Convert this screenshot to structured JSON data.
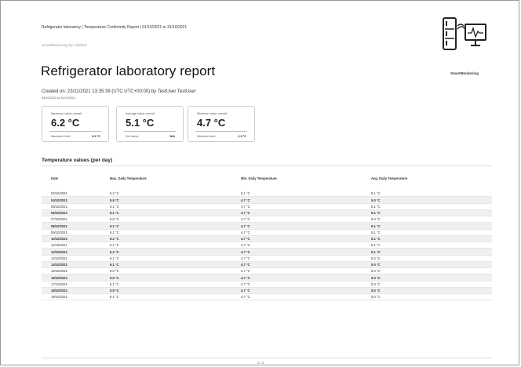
{
  "header": {
    "title": "Refrigerator laboratory | Temperature Conformity Report | 01/10/2021 to 31/10/2021",
    "subtitle": "SmartMonitoring by Liebherr",
    "logo_label": "SmartMonitoring"
  },
  "report": {
    "title": "Refrigerator laboratory report",
    "created": "Created on: 23/11/2021 13:35:39 (UTC UTC+00:00) by TestUser TestUser",
    "range": "03/10/2021 to 31/10/2021"
  },
  "cards": [
    {
      "label": "Maximum value overall:",
      "value": "6.2 °C",
      "limit_label": "Maximum limit:",
      "limit_value": "8.0 °C"
    },
    {
      "label": "Average value overall:",
      "value": "5.1 °C",
      "limit_label": "Set value:",
      "limit_value": "N/A"
    },
    {
      "label": "Minimum value overall:",
      "value": "4.7 °C",
      "limit_label": "Minimum limit:",
      "limit_value": "2.0 °C"
    }
  ],
  "table": {
    "title": "Temperature values (per day)",
    "headers": [
      "Date",
      "Max. Daily Temperature",
      "Min. Daily Temperature",
      "Avg. Daily Temperature"
    ],
    "rows": [
      [
        "03/10/2021",
        "5.2 °C",
        "5.1 °C",
        "5.1 °C"
      ],
      [
        "04/10/2021",
        "5.9 °C",
        "4.7 °C",
        "5.0 °C"
      ],
      [
        "05/10/2021",
        "6.1 °C",
        "4.7 °C",
        "5.1 °C"
      ],
      [
        "06/10/2021",
        "6.1 °C",
        "4.7 °C",
        "5.1 °C"
      ],
      [
        "07/10/2021",
        "5.8 °C",
        "4.7 °C",
        "5.0 °C"
      ],
      [
        "08/10/2021",
        "6.1 °C",
        "4.7 °C",
        "5.1 °C"
      ],
      [
        "09/10/2021",
        "6.1 °C",
        "4.7 °C",
        "5.1 °C"
      ],
      [
        "10/10/2021",
        "6.2 °C",
        "4.7 °C",
        "5.1 °C"
      ],
      [
        "11/10/2021",
        "6.1 °C",
        "4.7 °C",
        "5.1 °C"
      ],
      [
        "12/10/2021",
        "6.2 °C",
        "4.7 °C",
        "5.1 °C"
      ],
      [
        "13/10/2021",
        "6.1 °C",
        "4.7 °C",
        "5.0 °C"
      ],
      [
        "14/10/2021",
        "6.1 °C",
        "4.7 °C",
        "5.0 °C"
      ],
      [
        "15/10/2021",
        "6.0 °C",
        "4.7 °C",
        "5.0 °C"
      ],
      [
        "16/10/2021",
        "5.9 °C",
        "4.7 °C",
        "5.0 °C"
      ],
      [
        "17/10/2021",
        "6.1 °C",
        "4.7 °C",
        "5.0 °C"
      ],
      [
        "18/10/2021",
        "5.9 °C",
        "4.7 °C",
        "5.0 °C"
      ],
      [
        "19/10/2021",
        "6.1 °C",
        "4.7 °C",
        "5.0 °C"
      ]
    ]
  },
  "footer": {
    "page": "2 / 3"
  }
}
